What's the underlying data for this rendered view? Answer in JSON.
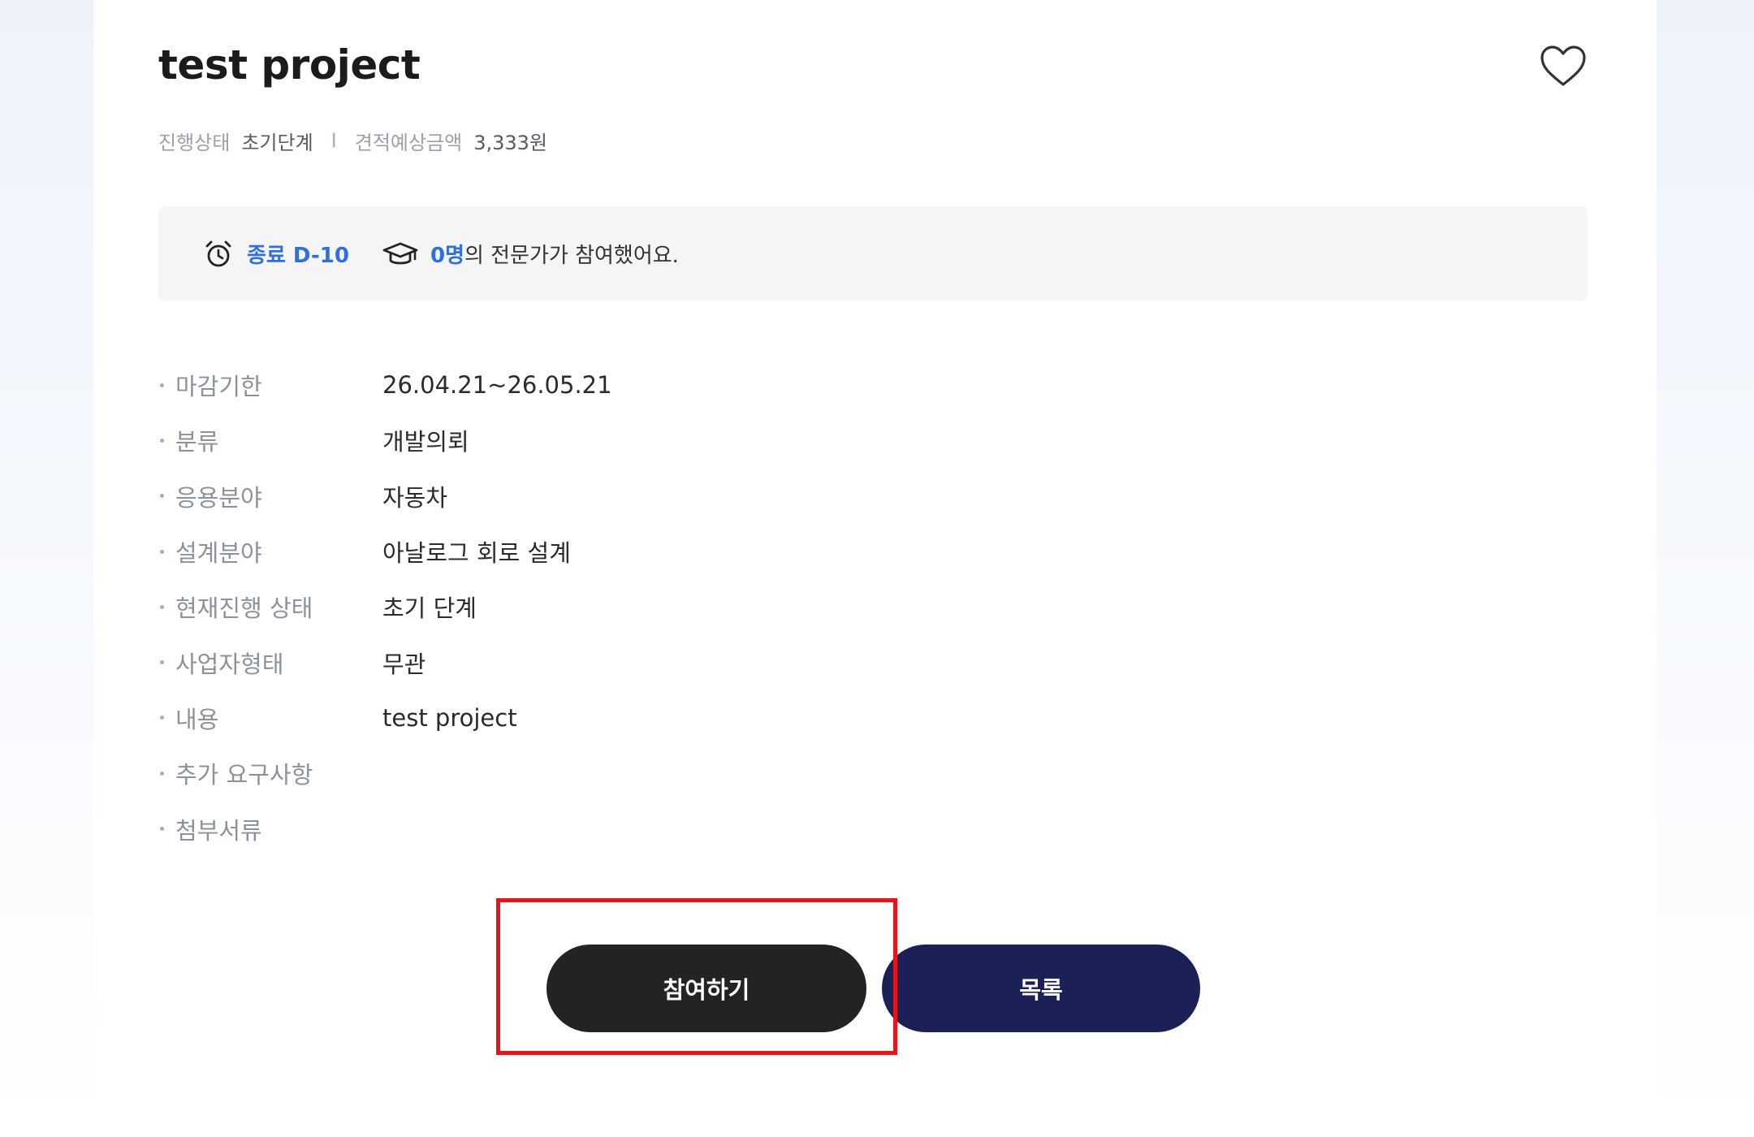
{
  "project": {
    "title": "test project"
  },
  "meta": {
    "status_label": "진행상태",
    "status_value": "초기단계",
    "separator": "I",
    "estimate_label": "견적예상금액",
    "estimate_value": "3,333원"
  },
  "notice": {
    "deadline": "종료 D-10",
    "count": "0명",
    "participants_suffix": "의 전문가가 참여했어요."
  },
  "details": [
    {
      "key": "마감기한",
      "value": "26.04.21~26.05.21"
    },
    {
      "key": "분류",
      "value": "개발의뢰"
    },
    {
      "key": "응용분야",
      "value": "자동차"
    },
    {
      "key": "설계분야",
      "value": "아날로그 회로 설계"
    },
    {
      "key": "현재진행 상태",
      "value": "초기 단계"
    },
    {
      "key": "사업자형태",
      "value": "무관"
    },
    {
      "key": "내용",
      "value": "test project"
    },
    {
      "key": "추가 요구사항",
      "value": ""
    },
    {
      "key": "첨부서류",
      "value": ""
    }
  ],
  "actions": {
    "join_label": "참여하기",
    "list_label": "목록"
  },
  "icons": {
    "favorite": "heart-icon",
    "deadline": "alarm-clock-icon",
    "participants": "graduation-cap-icon"
  },
  "colors": {
    "accent_blue": "#2f6fde",
    "join_button": "#232323",
    "list_button": "#1b2156",
    "highlight_box": "#e8141a"
  }
}
